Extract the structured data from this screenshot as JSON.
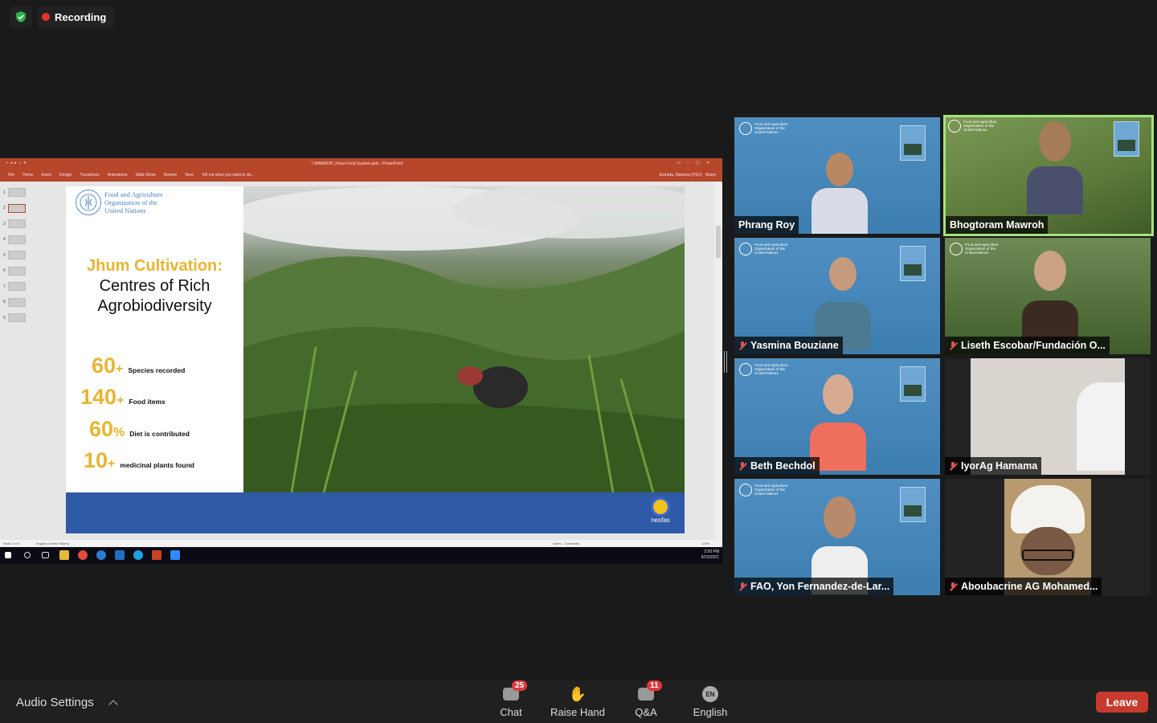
{
  "status": {
    "recording_label": "Recording"
  },
  "powerpoint": {
    "title": "7-MAWROH_Khasi Food System.pptx - PowerPoint",
    "tabs": [
      "File",
      "Home",
      "Insert",
      "Design",
      "Transitions",
      "Animations",
      "Slide Show",
      "Review",
      "View",
      "Tell me what you want to do..."
    ],
    "account": "Estrada, Mariana (FSU)",
    "share": "Share",
    "slide_count_label": "Slide 2 of 9",
    "language": "English (United States)",
    "notes": "Notes",
    "comments": "Comments",
    "zoom": "125%",
    "thumbnails": [
      "1",
      "2",
      "3",
      "4",
      "5",
      "6",
      "7",
      "8",
      "9"
    ],
    "clock_time": "2:50 PM",
    "clock_date": "6/23/2021"
  },
  "slide": {
    "org_line1": "Food and Agriculture",
    "org_line2": "Organization of the",
    "org_line3": "United Nations",
    "title": "Jhum Cultivation:",
    "subtitle1": "Centres of Rich",
    "subtitle2": "Agrobiodiversity",
    "stats": [
      {
        "num": "60",
        "unit": "+",
        "label": "Species recorded"
      },
      {
        "num": "140",
        "unit": "+",
        "label": "Food items"
      },
      {
        "num": "60",
        "unit": "%",
        "label": "Diet is contributed"
      },
      {
        "num": "10",
        "unit": "+",
        "label": "medicinal plants found"
      }
    ],
    "footer_logo_text": "nesfas"
  },
  "tile_brand": {
    "line1": "Food and Agriculture",
    "line2": "Organization of the",
    "line3": "United Nations"
  },
  "participants": [
    {
      "name": "Phrang Roy",
      "muted": false
    },
    {
      "name": "Bhogtoram Mawroh",
      "muted": false
    },
    {
      "name": "Yasmina Bouziane",
      "muted": true
    },
    {
      "name": "Liseth Escobar/Fundación O...",
      "muted": true
    },
    {
      "name": "Beth Bechdol",
      "muted": true
    },
    {
      "name": "IyorAg Hamama",
      "muted": true
    },
    {
      "name": "FAO, Yon Fernandez-de-Lar...",
      "muted": true
    },
    {
      "name": "Aboubacrine AG Mohamed...",
      "muted": true
    }
  ],
  "bottom": {
    "audio_settings": "Audio Settings",
    "chat_label": "Chat",
    "chat_badge": "25",
    "raise_hand_label": "Raise Hand",
    "qa_label": "Q&A",
    "qa_badge": "11",
    "language_label": "English",
    "language_code": "EN",
    "leave_label": "Leave"
  },
  "colors": {
    "ppt_red": "#b7472a",
    "slide_yellow": "#e8b533",
    "slide_blue": "#2f5aa8",
    "active_border": "#a6e27a",
    "leave_red": "#c83a2e"
  }
}
